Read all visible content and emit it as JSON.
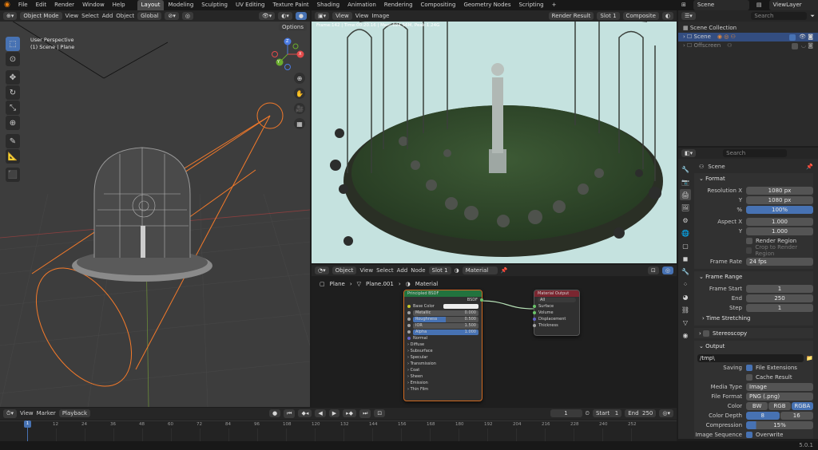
{
  "menu": [
    "File",
    "Edit",
    "Render",
    "Window",
    "Help"
  ],
  "workspaces": [
    "Layout",
    "Modeling",
    "Sculpting",
    "UV Editing",
    "Texture Paint",
    "Shading",
    "Animation",
    "Rendering",
    "Compositing",
    "Geometry Nodes",
    "Scripting"
  ],
  "active_workspace": "Layout",
  "top_right": {
    "scene": "Scene",
    "view_layer": "ViewLayer"
  },
  "viewport": {
    "mode": "Object Mode",
    "menus": [
      "View",
      "Select",
      "Add",
      "Object"
    ],
    "orientation": "Global",
    "options": "Options",
    "info_line1": "User Perspective",
    "info_line2": "(1) Scene | Plane",
    "gizmo": {
      "z": "Z",
      "y": "Y",
      "x": "X"
    }
  },
  "image_editor": {
    "menus": [
      "View",
      "View",
      "Image"
    ],
    "image_name": "Render Result",
    "slot": "Slot 1",
    "pass": "Composite",
    "frame_info": "Frame:142 | Time:00:20.16 | Mem:624.56M, Peak:1.24G"
  },
  "node_editor": {
    "type": "Object",
    "menus": [
      "View",
      "Select",
      "Add",
      "Node"
    ],
    "slot": "Slot 1",
    "material": "Material",
    "breadcrumbs": [
      "Plane",
      "Plane.001",
      "Material"
    ]
  },
  "bsdf": {
    "title": "Principled BSDF",
    "output": "BSDF",
    "rows": [
      {
        "name": "Base Color",
        "type": "color"
      },
      {
        "name": "Metallic",
        "value": "0.000"
      },
      {
        "name": "Roughness",
        "value": "0.500",
        "fill": 0.5
      },
      {
        "name": "IOR",
        "value": "1.500"
      },
      {
        "name": "Alpha",
        "value": "1.000",
        "fill": 1.0
      },
      {
        "name": "Normal",
        "type": "label"
      }
    ],
    "panels": [
      "Diffuse",
      "Subsurface",
      "Specular",
      "Transmission",
      "Coat",
      "Sheen",
      "Emission",
      "Thin Film"
    ]
  },
  "matout": {
    "title": "Material Output",
    "target": "All",
    "inputs": [
      "Surface",
      "Volume",
      "Displacement",
      "Thickness"
    ]
  },
  "outliner": {
    "search": "Search",
    "collection": "Scene Collection",
    "items": [
      "Scene",
      "Offscreen"
    ]
  },
  "props": {
    "search": "Search",
    "context": "Scene",
    "format": {
      "title": "Format",
      "res_x_label": "Resolution X",
      "res_x": "1080 px",
      "y_label": "Y",
      "res_y": "1080 px",
      "pct_label": "%",
      "pct": "100%",
      "aspect_x_label": "Aspect X",
      "aspect_x": "1.000",
      "aspect_y_label": "Y",
      "aspect_y": "1.000",
      "render_region": "Render Region",
      "crop": "Crop to Render Region",
      "frame_rate_label": "Frame Rate",
      "frame_rate": "24 fps"
    },
    "frame_range": {
      "title": "Frame Range",
      "start_label": "Frame Start",
      "start": "1",
      "end_label": "End",
      "end": "250",
      "step_label": "Step",
      "step": "1"
    },
    "time_stretching": "Time Stretching",
    "stereoscopy": "Stereoscopy",
    "output": {
      "title": "Output",
      "path": "/tmp\\",
      "saving_label": "Saving",
      "file_ext": "File Extensions",
      "cache": "Cache Result",
      "media_label": "Media Type",
      "media": "Image",
      "format_label": "File Format",
      "format": "PNG (.png)",
      "color_label": "Color",
      "color_opts": [
        "BW",
        "RGB",
        "RGBA"
      ],
      "depth_label": "Color Depth",
      "depth_opts": [
        "8",
        "16"
      ],
      "comp_label": "Compression",
      "comp": "15%",
      "seq_label": "Image Sequence",
      "overwrite": "Overwrite"
    }
  },
  "timeline": {
    "menus": [
      "View",
      "Marker",
      "Playback"
    ],
    "current": "1",
    "start_label": "Start",
    "start": "1",
    "end_label": "End",
    "end": "250",
    "ticks": [
      "1",
      "12",
      "24",
      "36",
      "48",
      "60",
      "72",
      "84",
      "96",
      "108",
      "120",
      "132",
      "144",
      "156",
      "168",
      "180",
      "192",
      "204",
      "216",
      "228",
      "240",
      "252"
    ]
  },
  "status": {
    "version": "5.0.1"
  }
}
